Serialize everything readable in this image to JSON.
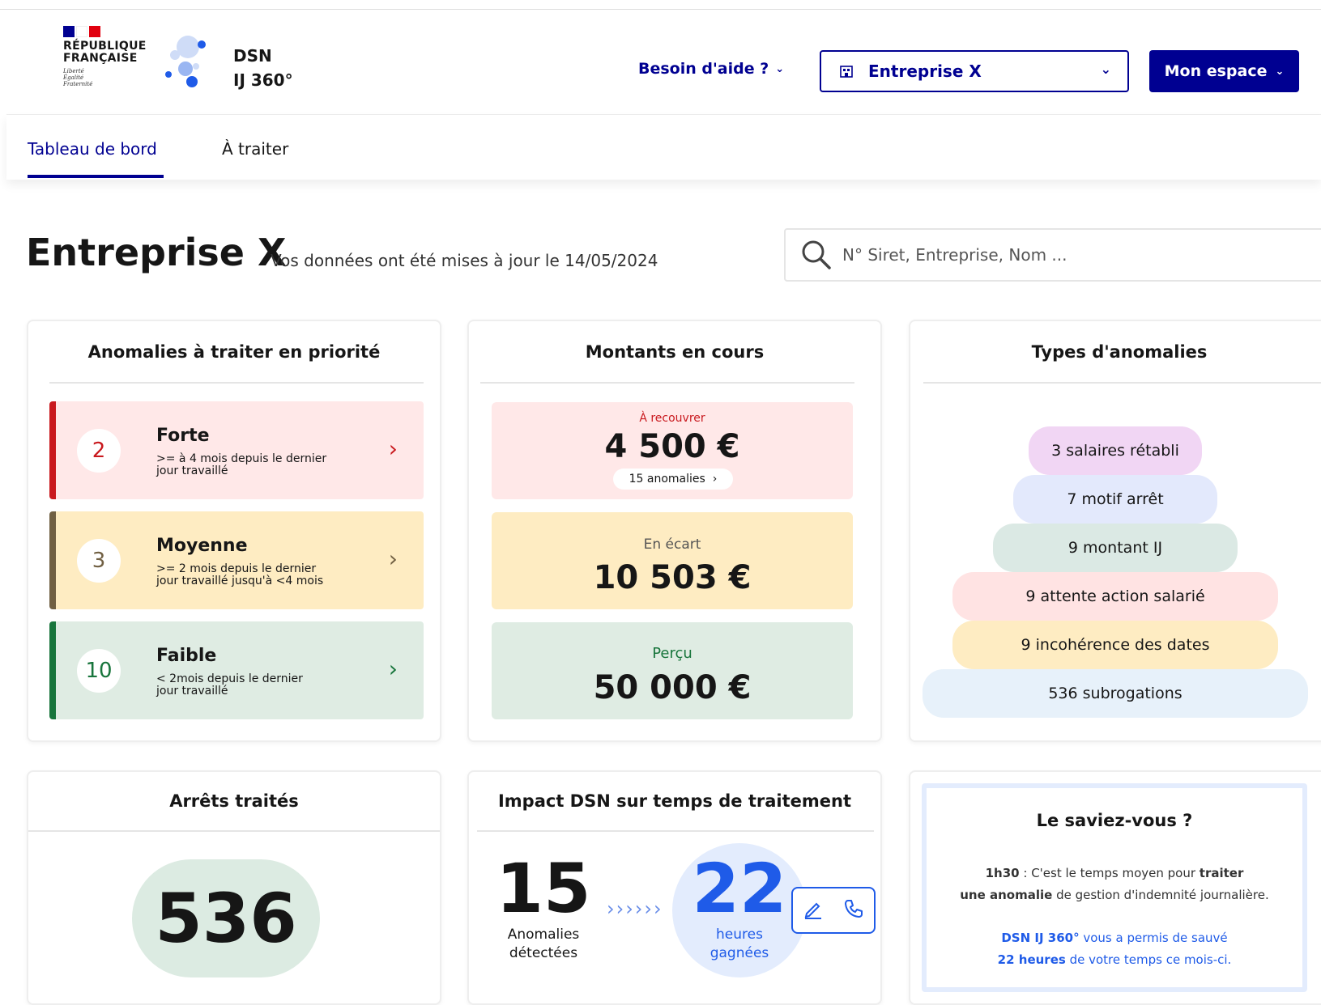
{
  "header": {
    "gov_name_line1": "RÉPUBLIQUE",
    "gov_name_line2": "FRANÇAISE",
    "motto_1": "Liberté",
    "motto_2": "Égalité",
    "motto_3": "Fraternité",
    "app_name_line1": "DSN",
    "app_name_line2": "IJ 360°",
    "help_label": "Besoin d'aide ?",
    "company_label": "Entreprise X",
    "account_label": "Mon espace"
  },
  "tabs": [
    {
      "label": "Tableau de bord"
    },
    {
      "label": "À traiter"
    }
  ],
  "page": {
    "title": "Entreprise X",
    "updated": "Vos données ont été mises à jour le 14/05/2024",
    "search_placeholder": "N° Siret, Entreprise, Nom ..."
  },
  "priority": {
    "title": "Anomalies à traiter en priorité",
    "items": [
      {
        "count": "2",
        "name": "Forte",
        "desc1": ">= à 4 mois depuis le dernier",
        "desc2": "jour travaillé"
      },
      {
        "count": "3",
        "name": "Moyenne",
        "desc1": ">= 2 mois depuis le dernier",
        "desc2": "jour travaillé jusqu'à <4 mois"
      },
      {
        "count": "10",
        "name": "Faible",
        "desc1": "< 2mois depuis le dernier",
        "desc2": "jour travaillé"
      }
    ]
  },
  "amounts": {
    "title": "Montants en cours",
    "recover_label": "À recouvrer",
    "recover_value": "4 500 €",
    "recover_link": "15 anomalies",
    "gap_label": "En écart",
    "gap_value": "10 503 €",
    "received_label": "Perçu",
    "received_value": "50 000 €"
  },
  "types": {
    "title": "Types d'anomalies",
    "items": [
      "3 salaires rétabli",
      "7 motif arrêt",
      "9 montant IJ",
      "9 attente action salarié",
      "9 incohérence des dates",
      "536 subrogations"
    ]
  },
  "stops": {
    "title": "Arrêts traités",
    "value": "536"
  },
  "impact": {
    "title": "Impact DSN sur temps de traitement",
    "anomalies_value": "15",
    "anomalies_label1": "Anomalies",
    "anomalies_label2": "détectées",
    "arrows": "››››››",
    "hours_value": "22",
    "hours_label1": "heures",
    "hours_label2": "gagnées"
  },
  "fact": {
    "title": "Le saviez-vous ?",
    "line1_b": "1h30",
    "line1_a": " : C'est le temps moyen pour ",
    "line1_c": "traiter",
    "line2_b": "une anomalie",
    "line2_a": " de gestion d'indemnité journalière.",
    "line3_b": "DSN IJ 360°",
    "line3_a": " vous a permis de sauvé",
    "line4_b": "22 heures",
    "line4_a": " de votre temps ce mois-ci."
  },
  "colors": {
    "primary": "#000091",
    "forte": "#c9191e",
    "moyenne": "#716043",
    "faible": "#18753c"
  }
}
